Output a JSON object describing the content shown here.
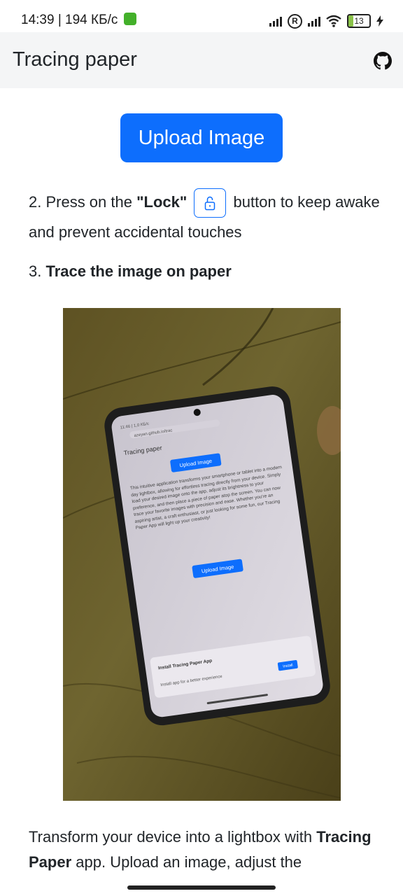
{
  "status_bar": {
    "time": "14:39",
    "speed": "194 КБ/с",
    "battery": "13"
  },
  "navbar": {
    "title": "Tracing paper",
    "github_icon": "github-icon"
  },
  "main": {
    "upload_button": "Upload Image",
    "step2_prefix": "2. Press on the ",
    "step2_lock": "\"Lock\"",
    "step2_suffix": " button to keep awake and prevent accidental touches",
    "step3_prefix": "3. ",
    "step3_bold": "Trace the image on paper",
    "photo_icon": "photo-example",
    "photo_screen": {
      "status": "11:46 | 1,0 КБ/с",
      "url": "azeyan.github.io/trac",
      "title": "Tracing paper",
      "upload_button": "Upload Image",
      "paragraph": "This intuitive application transforms your smartphone or tablet into a modern day lightbox, allowing for effortless tracing directly from your device. Simply load your desired image onto the app, adjust its brightness to your preference, and then place a piece of paper atop the screen. You can now trace your favorite images with precision and ease. Whether you're an aspiring artist, a craft enthusiast, or just looking for some fun, our Tracing Paper App will light up your creativity!",
      "upload_button_2": "Upload Image",
      "install_title": "Install Tracing Paper App",
      "install_text": "Install app for a better experience",
      "install_button": "Install"
    },
    "bottom_text_1": "Transform your device into a lightbox with ",
    "bottom_bold": "Tracing Paper",
    "bottom_text_2": " app. Upload an image, adjust the"
  },
  "colors": {
    "primary": "#0d6efd",
    "navbar_bg": "#f4f5f6",
    "text": "#212529"
  }
}
